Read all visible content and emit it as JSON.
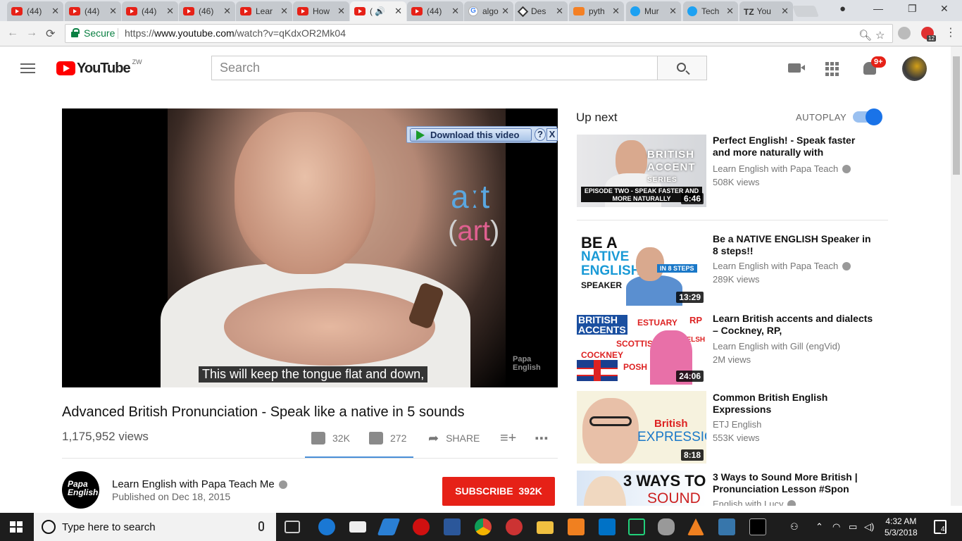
{
  "browser": {
    "tabs": [
      {
        "icon": "youtube-icon",
        "label": "(44)"
      },
      {
        "icon": "youtube-icon",
        "label": "(44)"
      },
      {
        "icon": "youtube-icon",
        "label": "(44)"
      },
      {
        "icon": "youtube-icon",
        "label": "(46)"
      },
      {
        "icon": "youtube-icon",
        "label": "Lear"
      },
      {
        "icon": "youtube-icon",
        "label": "How"
      },
      {
        "icon": "youtube-icon",
        "label": "( 🔊"
      },
      {
        "icon": "youtube-icon",
        "label": "(44)"
      },
      {
        "icon": "google-icon",
        "label": "algo"
      },
      {
        "icon": "diamond-icon",
        "label": "Des"
      },
      {
        "icon": "stackoverflow-icon",
        "label": "pyth"
      },
      {
        "icon": "twitter-icon",
        "label": "Mur"
      },
      {
        "icon": "twitter-icon",
        "label": "Tech"
      },
      {
        "icon": "tz-icon",
        "label": "You"
      }
    ],
    "secure_label": "Secure",
    "url_prefix": "https://",
    "url_host": "www.youtube.com",
    "url_path": "/watch?v=qKdxOR2Mk04",
    "ext_badge": "12"
  },
  "youtube": {
    "logo_text": "YouTube",
    "country_code": "ZW",
    "search_placeholder": "Search",
    "notif_count": "9+"
  },
  "video": {
    "overlay_ipa": "aːt",
    "overlay_word_open": "(",
    "overlay_word": "art",
    "overlay_word_close": ")",
    "watermark_line1": "Papa",
    "watermark_line2": "English",
    "caption": "This will keep the tongue flat and down,",
    "download_label": "Download this video",
    "download_help": "?",
    "download_close": "X",
    "title": "Advanced British Pronunciation - Speak like a native in 5 sounds",
    "views": "1,175,952 views",
    "likes": "32K",
    "dislikes": "272",
    "share_label": "SHARE",
    "channel_logo_l1": "Papa",
    "channel_logo_l2": "English",
    "channel_name": "Learn English with Papa Teach Me",
    "published": "Published on Dec 18, 2015",
    "subscribe_label": "SUBSCRIBE",
    "subscriber_count": "392K"
  },
  "sidebar": {
    "up_next_label": "Up next",
    "autoplay_label": "AUTOPLAY",
    "autoplay_on": true,
    "items": [
      {
        "title": "Perfect English! - Speak faster and more naturally with",
        "channel": "Learn English with Papa Teach",
        "views": "508K views",
        "duration": "6:46",
        "thumb_text": "BRITISH ACCENT",
        "thumb_series": "SERIES",
        "thumb_bar": "EPISODE TWO - SPEAK FASTER AND MORE NATURALLY"
      },
      {
        "title": "Be a NATIVE ENGLISH Speaker in 8 steps!!",
        "channel": "Learn English with Papa Teach",
        "views": "289K views",
        "duration": "13:29",
        "thumb_l1": "BE A",
        "thumb_l2": "NATIVE",
        "thumb_l3": "ENGLISH",
        "thumb_l4": "SPEAKER",
        "thumb_tag": "IN 8 STEPS"
      },
      {
        "title": "Learn British accents and dialects – Cockney, RP,",
        "channel": "Learn English with Gill (engVid)",
        "views": "2M views",
        "duration": "24:06",
        "thumb_l1": "BRITISH",
        "thumb_l2": "ACCENTS",
        "thumb_w1": "ESTUARY",
        "thumb_w2": "RP",
        "thumb_w3": "SCOTTISH",
        "thumb_w4": "WELSH",
        "thumb_w5": "COCKNEY",
        "thumb_w6": "POSH"
      },
      {
        "title": "Common British English Expressions",
        "channel": "ETJ English",
        "views": "553K views",
        "duration": "8:18",
        "thumb_w1": "British",
        "thumb_w2": "EXPRESSIONS"
      },
      {
        "title": "3 Ways to Sound More British | Pronunciation Lesson #Spon",
        "channel": "English with Lucy",
        "thumb_l1": "3 WAYS TO",
        "thumb_l2": "SOUND"
      }
    ]
  },
  "taskbar": {
    "search_placeholder": "Type here to search",
    "time": "4:32 AM",
    "date": "5/3/2018",
    "notif_count": "4"
  }
}
